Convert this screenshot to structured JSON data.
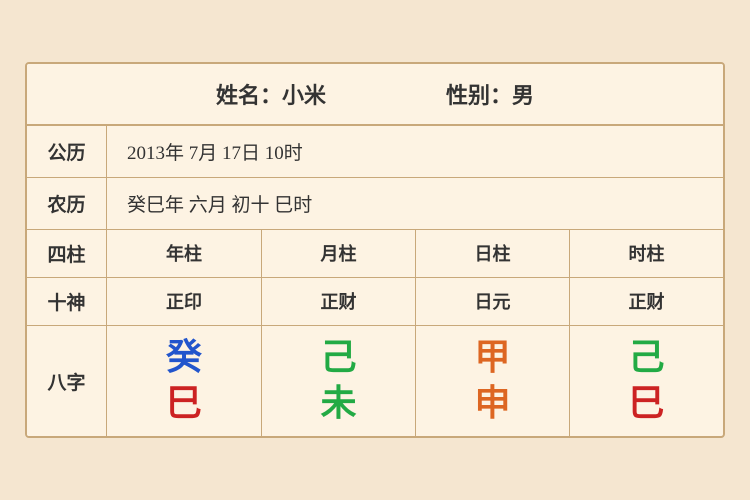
{
  "header": {
    "name_label": "姓名：小米",
    "gender_label": "性别：男"
  },
  "rows": {
    "solar_label": "公历",
    "solar_value": "2013年 7月 17日 10时",
    "lunar_label": "农历",
    "lunar_value": "癸巳年 六月 初十 巳时"
  },
  "pillars": {
    "label": "四柱",
    "headers": [
      "年柱",
      "月柱",
      "日柱",
      "时柱"
    ]
  },
  "gods": {
    "label": "十神",
    "values": [
      "正印",
      "正财",
      "日元",
      "正财"
    ]
  },
  "bazi": {
    "label": "八字",
    "cells": [
      {
        "top": "癸",
        "bottom": "巳",
        "top_color": "blue",
        "bottom_color": "red"
      },
      {
        "top": "己",
        "bottom": "未",
        "top_color": "green",
        "bottom_color": "green"
      },
      {
        "top": "甲",
        "bottom": "申",
        "top_color": "orange",
        "bottom_color": "orange"
      },
      {
        "top": "己",
        "bottom": "巳",
        "top_color": "green",
        "bottom_color": "red"
      }
    ]
  }
}
